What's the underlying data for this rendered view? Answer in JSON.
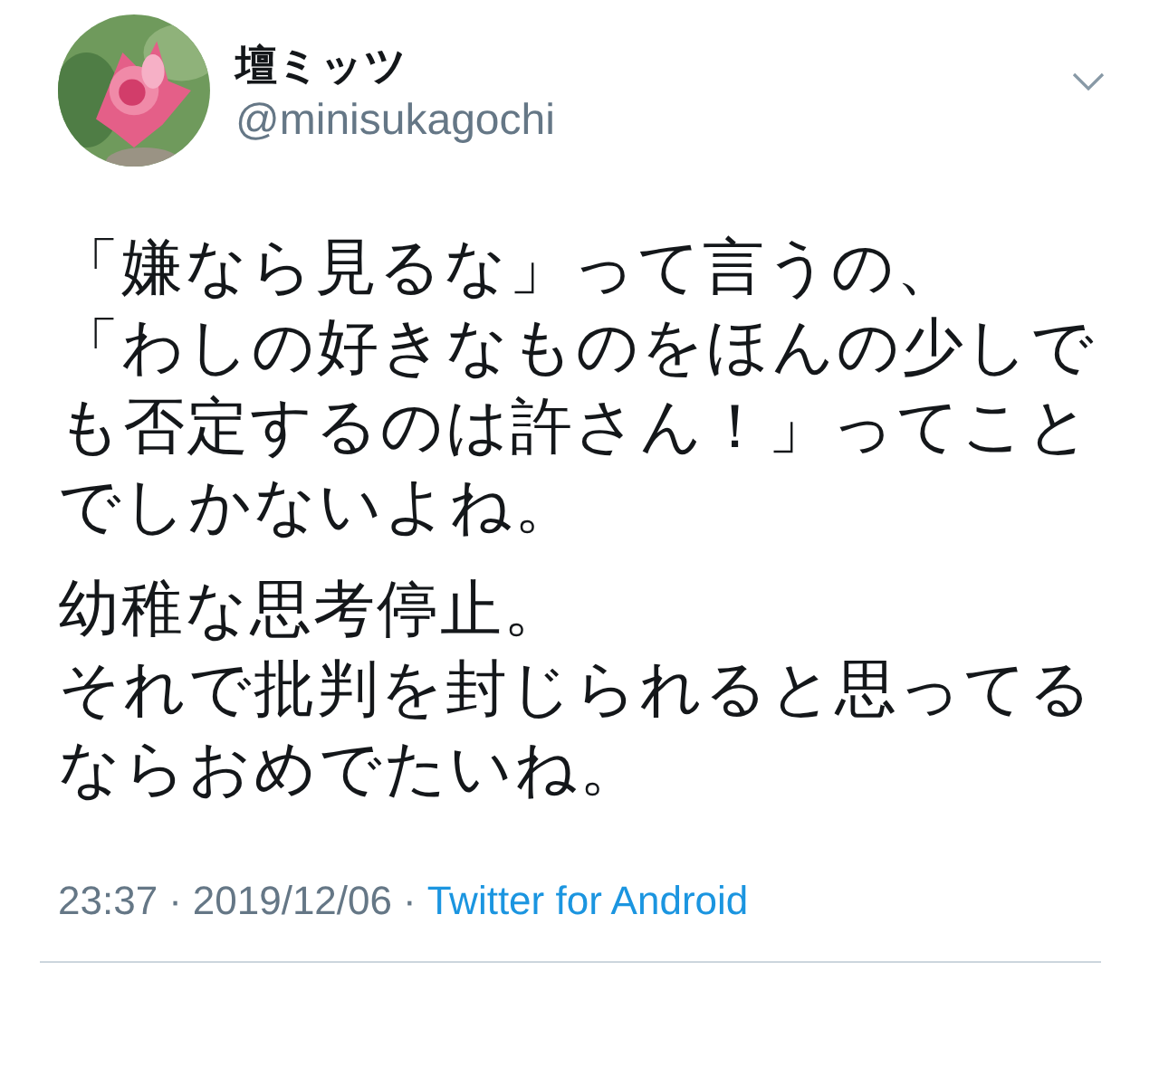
{
  "tweet": {
    "author": {
      "name": "壇ミッツ",
      "handle": "@minisukagochi"
    },
    "paragraphs": [
      [
        "「嫌なら見るな」って言うの、",
        "「わしの好きなものをほんの少しでも否定するのは許さん！」ってことでしかないよね。"
      ],
      [
        "幼稚な思考停止。",
        "それで批判を封じられると思ってるならおめでたいね。"
      ]
    ],
    "time": "23:37",
    "date": "2019/12/06",
    "separator": "·",
    "source": "Twitter for Android"
  }
}
